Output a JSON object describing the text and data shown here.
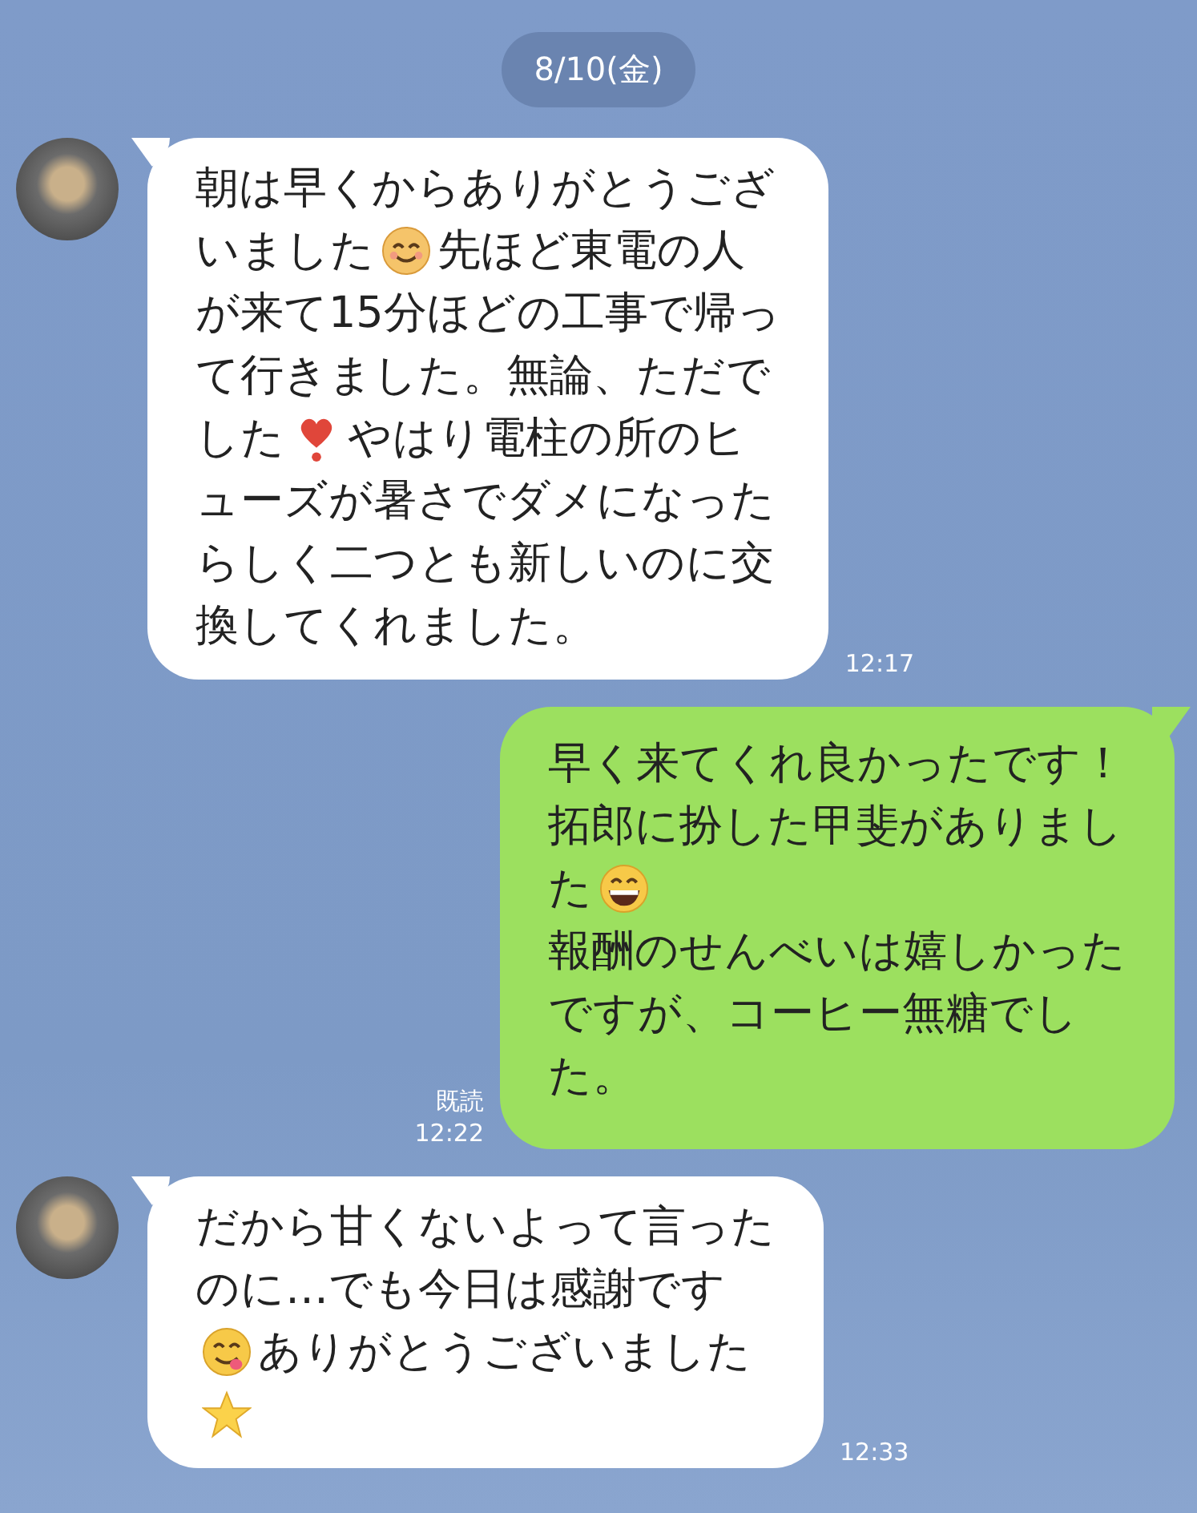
{
  "date_label": "8/10(金)",
  "messages": [
    {
      "kind": "incoming",
      "time": "12:17",
      "lines": [
        [
          {
            "kind": "text",
            "text": "朝は早くからありがとうござ"
          }
        ],
        [
          {
            "kind": "text",
            "text": "いました"
          },
          {
            "kind": "smiling"
          },
          {
            "kind": "text",
            "text": "先ほど東電の人"
          }
        ],
        [
          {
            "kind": "text",
            "text": "が来て15分ほどの工事で帰っ"
          }
        ],
        [
          {
            "kind": "text",
            "text": "て行きました。無論、ただで"
          }
        ],
        [
          {
            "kind": "text",
            "text": "した"
          },
          {
            "kind": "heart"
          },
          {
            "kind": "text",
            "text": "やはり電柱の所のヒ"
          }
        ],
        [
          {
            "kind": "text",
            "text": "ューズが暑さでダメになった"
          }
        ],
        [
          {
            "kind": "text",
            "text": "らしく二つとも新しいのに交"
          }
        ],
        [
          {
            "kind": "text",
            "text": "換してくれました。"
          }
        ]
      ]
    },
    {
      "kind": "outgoing",
      "read": "既読",
      "time": "12:22",
      "lines": [
        [
          {
            "kind": "text",
            "text": "早く来てくれ良かったです！"
          }
        ],
        [
          {
            "kind": "text",
            "text": "拓郎に扮した甲斐がありまし"
          }
        ],
        [
          {
            "kind": "text",
            "text": "た"
          },
          {
            "kind": "grinning"
          }
        ],
        [
          {
            "kind": "text",
            "text": "報酬のせんべいは嬉しかった"
          }
        ],
        [
          {
            "kind": "text",
            "text": "ですが、コーヒー無糖でし"
          }
        ],
        [
          {
            "kind": "text",
            "text": "た。"
          }
        ]
      ]
    },
    {
      "kind": "incoming",
      "time": "12:33",
      "lines": [
        [
          {
            "kind": "text",
            "text": "だから甘くないよって言った"
          }
        ],
        [
          {
            "kind": "text",
            "text": "のに…でも今日は感謝です"
          }
        ],
        [
          {
            "kind": "yum"
          },
          {
            "kind": "text",
            "text": "ありがとうございました"
          }
        ],
        [
          {
            "kind": "star"
          }
        ]
      ]
    }
  ]
}
